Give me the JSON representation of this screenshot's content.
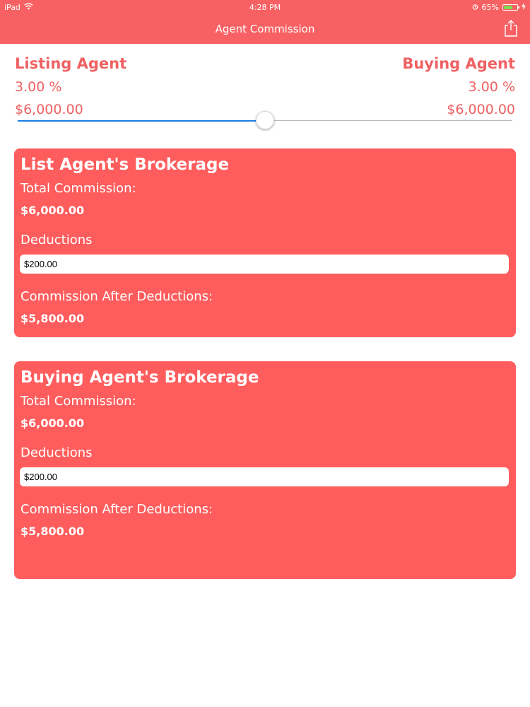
{
  "status_bar": {
    "device": "iPad",
    "time": "4:28 PM",
    "battery": "65%"
  },
  "nav": {
    "title": "Agent Commission"
  },
  "listing_agent": {
    "label": "Listing Agent",
    "percent": "3.00 %",
    "amount": "$6,000.00"
  },
  "buying_agent": {
    "label": "Buying Agent",
    "percent": "3.00 %",
    "amount": "$6,000.00"
  },
  "split_slider": {
    "value": 0.5
  },
  "list_brokerage": {
    "title": "List Agent's Brokerage",
    "total_label": "Total Commission:",
    "total_value": "$6,000.00",
    "deductions_label": "Deductions",
    "deductions_value": "$200.00",
    "after_label": "Commission After Deductions:",
    "after_value": "$5,800.00"
  },
  "buying_brokerage": {
    "title": "Buying Agent's Brokerage",
    "total_label": "Total Commission:",
    "total_value": "$6,000.00",
    "deductions_label": "Deductions",
    "deductions_value": "$200.00",
    "after_label": "Commission After Deductions:",
    "after_value": "$5,800.00"
  },
  "colors": {
    "accent": "#f86163",
    "card": "#ff5d5d",
    "slider_active": "#1a7ee6"
  },
  "icons": {
    "wifi": "wifi-icon",
    "alarm": "alarm-icon",
    "battery": "battery-icon",
    "charging": "charging-icon",
    "share": "share-icon"
  }
}
